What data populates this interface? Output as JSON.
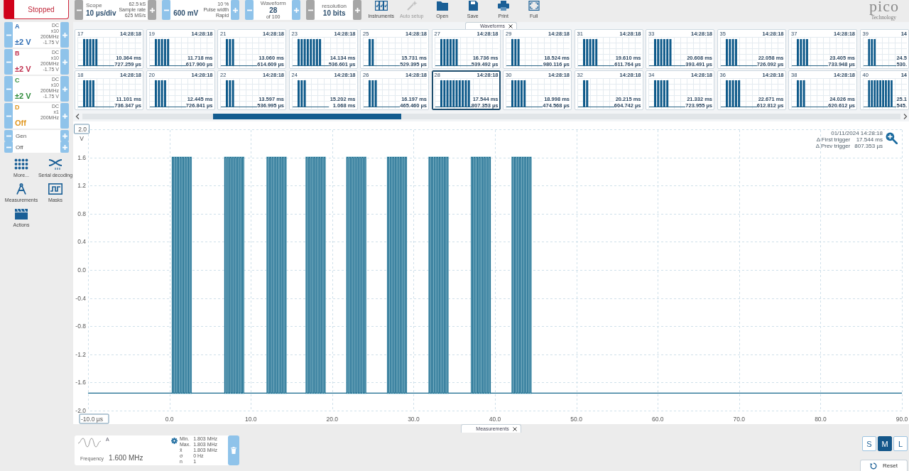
{
  "toolbar": {
    "run_button": {
      "label": "Stopped"
    },
    "groups": [
      {
        "kind": "split",
        "disabled": true,
        "title": "Scope",
        "value": "10 µs/div",
        "details": [
          "62.5 kS",
          "Sample rate",
          "625 MS/s"
        ]
      },
      {
        "kind": "split",
        "disabled": false,
        "value": "600 mV",
        "details": [
          "10 %",
          "Pulse width",
          "Rapid"
        ]
      },
      {
        "kind": "stacked",
        "disabled": false,
        "title": "Waveform",
        "value": "28",
        "details": [
          "of 100"
        ]
      },
      {
        "kind": "stacked",
        "disabled": true,
        "title": "resolution",
        "value": "10 bits"
      }
    ],
    "tools": [
      {
        "label": "Instruments",
        "disabled": false
      },
      {
        "label": "Auto setup",
        "disabled": true
      },
      {
        "label": "Open",
        "disabled": false
      },
      {
        "label": "Save",
        "disabled": false
      },
      {
        "label": "Print",
        "disabled": false
      },
      {
        "label": "Full",
        "disabled": false
      }
    ],
    "logo": {
      "wordmark": "pico",
      "tagline": "Technology"
    }
  },
  "channels": [
    {
      "name": "A",
      "range": "±2 V",
      "color": "#2f6db3",
      "details": [
        "DC",
        "x10",
        "200MHz",
        "-1.75 V"
      ]
    },
    {
      "name": "B",
      "range": "±2 V",
      "color": "#c0304f",
      "details": [
        "DC",
        "x10",
        "200MHz",
        "-1.75 V"
      ]
    },
    {
      "name": "C",
      "range": "±2 V",
      "color": "#2e8b3a",
      "details": [
        "DC",
        "x10",
        "200MHz",
        "-1.75 V"
      ]
    },
    {
      "name": "D",
      "range": "Off",
      "color": "#e0961e",
      "details": [
        "DC",
        "x1",
        "200MHz"
      ]
    }
  ],
  "generator": [
    {
      "label": "Gen"
    },
    {
      "label": "Off"
    }
  ],
  "sidebar_tools": [
    {
      "label": "More..."
    },
    {
      "label": "Serial decoding"
    },
    {
      "label": "Measurements"
    },
    {
      "label": "Masks"
    },
    {
      "label": "Actions"
    }
  ],
  "waveforms_panel": {
    "tab": "Waveforms",
    "thumbnails": [
      {
        "number": "17",
        "time": "14:28:18",
        "delta_first": "10.364 ms",
        "delta_prev": "727.259 µs",
        "selected": false
      },
      {
        "number": "19",
        "time": "14:28:18",
        "delta_first": "11.718 ms",
        "delta_prev": "617.900 µs",
        "selected": false
      },
      {
        "number": "21",
        "time": "14:28:18",
        "delta_first": "13.060 ms",
        "delta_prev": "614.609 µs",
        "selected": false
      },
      {
        "number": "23",
        "time": "14:28:18",
        "delta_first": "14.134 ms",
        "delta_prev": "536.601 µs",
        "selected": false
      },
      {
        "number": "25",
        "time": "14:28:18",
        "delta_first": "15.731 ms",
        "delta_prev": "529.395 µs",
        "selected": false
      },
      {
        "number": "27",
        "time": "14:28:18",
        "delta_first": "16.736 ms",
        "delta_prev": "539.492 µs",
        "selected": false
      },
      {
        "number": "29",
        "time": "14:28:18",
        "delta_first": "18.524 ms",
        "delta_prev": "980.116 µs",
        "selected": false
      },
      {
        "number": "31",
        "time": "14:28:18",
        "delta_first": "19.610 ms",
        "delta_prev": "611.764 µs",
        "selected": false
      },
      {
        "number": "33",
        "time": "14:28:18",
        "delta_first": "20.608 ms",
        "delta_prev": "393.491 µs",
        "selected": false
      },
      {
        "number": "35",
        "time": "14:28:18",
        "delta_first": "22.058 ms",
        "delta_prev": "726.092 µs",
        "selected": false
      },
      {
        "number": "37",
        "time": "14:28:18",
        "delta_first": "23.405 ms",
        "delta_prev": "733.948 µs",
        "selected": false
      },
      {
        "number": "39",
        "time": "14",
        "delta_first": "24.5",
        "delta_prev": "530.",
        "selected": false
      },
      {
        "number": "18",
        "time": "14:28:18",
        "delta_first": "11.101 ms",
        "delta_prev": "736.347 µs",
        "selected": false
      },
      {
        "number": "20",
        "time": "14:28:18",
        "delta_first": "12.445 ms",
        "delta_prev": "726.841 µs",
        "selected": false
      },
      {
        "number": "22",
        "time": "14:28:18",
        "delta_first": "13.597 ms",
        "delta_prev": "536.995 µs",
        "selected": false
      },
      {
        "number": "24",
        "time": "14:28:18",
        "delta_first": "15.202 ms",
        "delta_prev": "1.068 ms",
        "selected": false
      },
      {
        "number": "26",
        "time": "14:28:18",
        "delta_first": "16.197 ms",
        "delta_prev": "465.460 µs",
        "selected": false
      },
      {
        "number": "28",
        "time": "14:28:18",
        "delta_first": "17.544 ms",
        "delta_prev": "807.353 µs",
        "selected": true
      },
      {
        "number": "30",
        "time": "14:28:18",
        "delta_first": "18.998 ms",
        "delta_prev": "474.568 µs",
        "selected": false
      },
      {
        "number": "32",
        "time": "14:28:18",
        "delta_first": "20.215 ms",
        "delta_prev": "604.742 µs",
        "selected": false
      },
      {
        "number": "34",
        "time": "14:28:18",
        "delta_first": "21.332 ms",
        "delta_prev": "723.955 µs",
        "selected": false
      },
      {
        "number": "36",
        "time": "14:28:18",
        "delta_first": "22.671 ms",
        "delta_prev": "612.812 µs",
        "selected": false
      },
      {
        "number": "38",
        "time": "14:28:18",
        "delta_first": "24.026 ms",
        "delta_prev": "620.612 µs",
        "selected": false
      },
      {
        "number": "40",
        "time": "14",
        "delta_first": "25.1",
        "delta_prev": "545.",
        "selected": false
      }
    ]
  },
  "scope_view": {
    "y_labels": [
      "2.0",
      "1.6",
      "1.2",
      "0.8",
      "0.4",
      "0.0",
      "-0.4",
      "-0.8",
      "-1.2",
      "-1.6",
      "-2.0"
    ],
    "y_unit": "V",
    "x_labels": [
      "-10.0 µs",
      "0.0",
      "10.0",
      "20.0",
      "30.0",
      "40.0",
      "50.0",
      "60.0",
      "70.0",
      "80.0",
      "90.0"
    ],
    "info": {
      "timestamp": "01/11/2024 14:28:18",
      "rows": [
        {
          "label": "Δ First trigger",
          "value": "17.544 ms"
        },
        {
          "label": "Δ Prev trigger",
          "value": "807.353 µs"
        }
      ]
    }
  },
  "measurements": {
    "tab": "Measurements",
    "items": [
      {
        "channel": "A",
        "name": "Frequency",
        "value": "1.600 MHz",
        "stats": [
          {
            "label": "Min.",
            "value": "1.803 MHz"
          },
          {
            "label": "Max.",
            "value": "1.803 MHz"
          },
          {
            "label": "x̄",
            "value": "1.803 MHz"
          },
          {
            "label": "σ",
            "value": "0 Hz"
          },
          {
            "label": "n",
            "value": "1"
          }
        ]
      }
    ]
  },
  "view_controls": {
    "sizes": [
      {
        "label": "S",
        "selected": false
      },
      {
        "label": "M",
        "selected": true
      },
      {
        "label": "L",
        "selected": false
      }
    ],
    "reset": "Reset"
  }
}
